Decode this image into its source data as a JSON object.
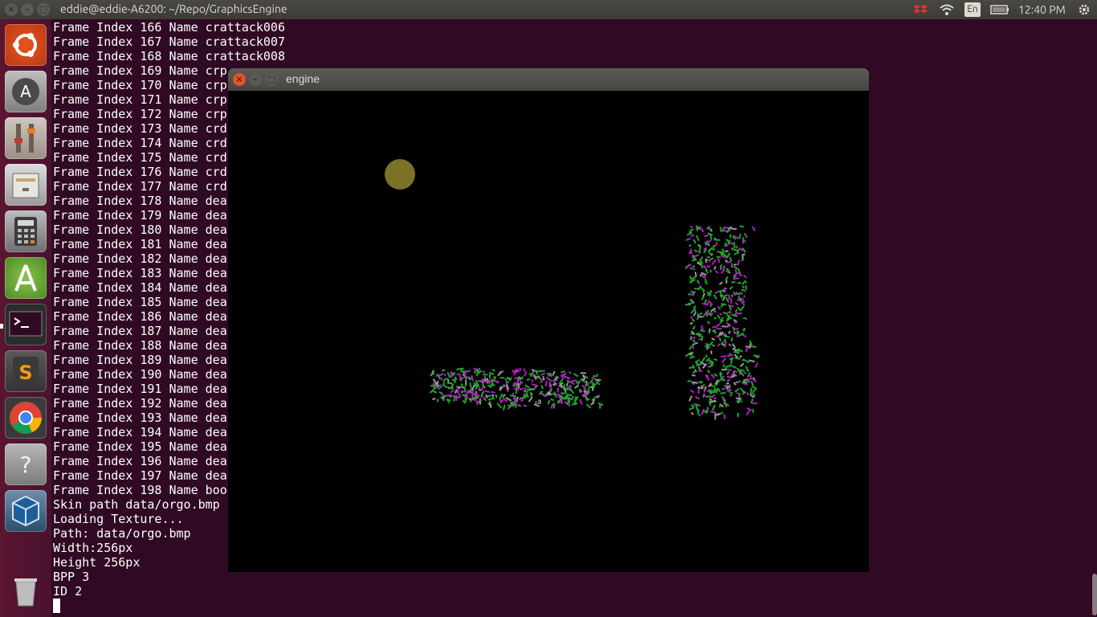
{
  "topbar": {
    "title": "eddie@eddie-A6200: ~/Repo/GraphicsEngine",
    "keyboard_layout": "En",
    "time": "12:40 PM",
    "tray_icons": [
      "dropbox-icon",
      "wifi-icon",
      "keyboard-icon",
      "battery-icon",
      "settings-gear-icon"
    ]
  },
  "launcher": {
    "items": [
      {
        "name": "ubuntu-dash",
        "icon": "ubuntu-icon"
      },
      {
        "name": "software-updater",
        "icon": "updater-icon"
      },
      {
        "name": "system-settings",
        "icon": "mixer-icon"
      },
      {
        "name": "file-cabinet",
        "icon": "cabinet-icon"
      },
      {
        "name": "calculator",
        "icon": "calculator-icon"
      },
      {
        "name": "android-studio",
        "icon": "android-studio-icon"
      },
      {
        "name": "terminal",
        "icon": "terminal-icon"
      },
      {
        "name": "sublime-text",
        "icon": "sublime-icon"
      },
      {
        "name": "chrome",
        "icon": "chrome-icon"
      },
      {
        "name": "help",
        "icon": "help-icon"
      },
      {
        "name": "virtualbox",
        "icon": "virtualbox-icon"
      },
      {
        "name": "trash",
        "icon": "trash-icon"
      }
    ]
  },
  "terminal": {
    "lines": [
      "Frame Index 166 Name crattack006",
      "Frame Index 167 Name crattack007",
      "Frame Index 168 Name crattack008",
      "Frame Index 169 Name crp",
      "Frame Index 170 Name crp",
      "Frame Index 171 Name crp",
      "Frame Index 172 Name crp",
      "Frame Index 173 Name crd",
      "Frame Index 174 Name crd",
      "Frame Index 175 Name crd",
      "Frame Index 176 Name crd",
      "Frame Index 177 Name crd",
      "Frame Index 178 Name dea",
      "Frame Index 179 Name dea",
      "Frame Index 180 Name dea",
      "Frame Index 181 Name dea",
      "Frame Index 182 Name dea",
      "Frame Index 183 Name dea",
      "Frame Index 184 Name dea",
      "Frame Index 185 Name dea",
      "Frame Index 186 Name dea",
      "Frame Index 187 Name dea",
      "Frame Index 188 Name dea",
      "Frame Index 189 Name dea",
      "Frame Index 190 Name dea",
      "Frame Index 191 Name dea",
      "Frame Index 192 Name dea",
      "Frame Index 193 Name dea",
      "Frame Index 194 Name dea",
      "Frame Index 195 Name dea",
      "Frame Index 196 Name dea",
      "Frame Index 197 Name dea",
      "Frame Index 198 Name boo",
      "Skin path data/orgo.bmp",
      "Loading Texture...",
      "Path: data/orgo.bmp",
      "Width:256px",
      "Height 256px",
      "BPP 3",
      "ID 2"
    ]
  },
  "engine_window": {
    "title": "engine",
    "colors": {
      "moon": "#7a7326",
      "green": "#1fa52a",
      "magenta": "#b11fbf",
      "grey": "#9a9a9a"
    }
  }
}
